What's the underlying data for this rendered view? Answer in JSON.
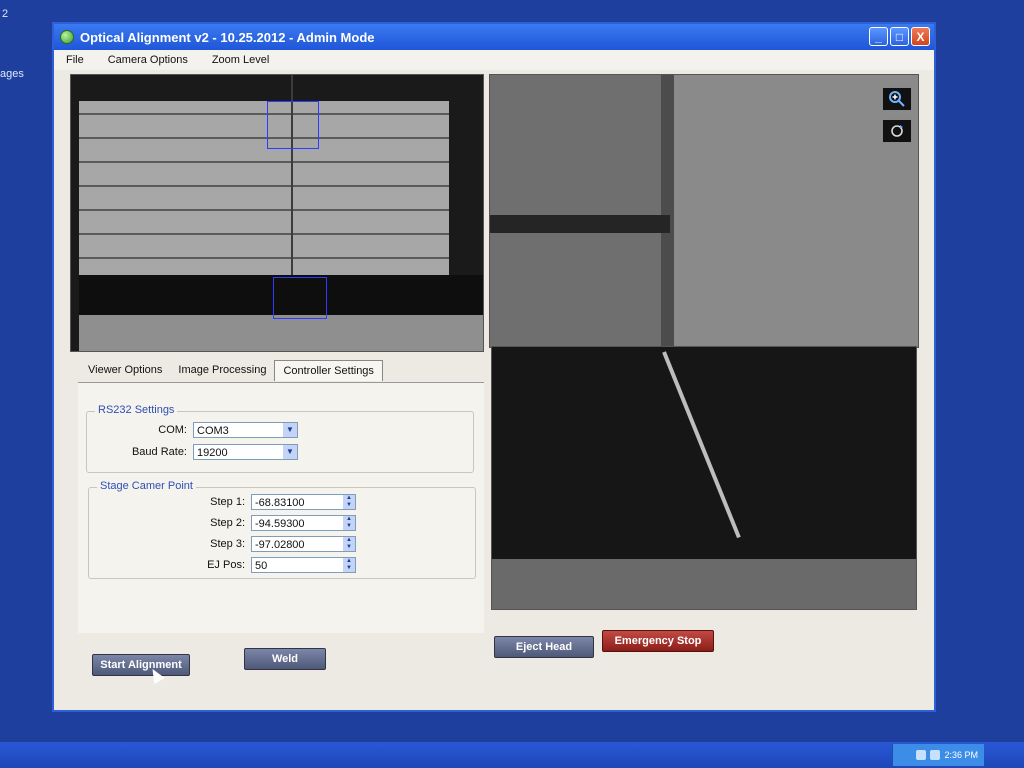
{
  "desktop": {
    "left_texts": [
      "2",
      "ages"
    ]
  },
  "window": {
    "title": "Optical Alignment v2 - 10.25.2012 - Admin Mode",
    "buttons": [
      "_",
      "□",
      "X"
    ]
  },
  "menu": {
    "items": [
      "File",
      "Camera Options",
      "Zoom Level"
    ]
  },
  "tabs": [
    "Viewer Options",
    "Image Processing",
    "Controller Settings"
  ],
  "rs232": {
    "group_title": "RS232 Settings",
    "com_label": "COM:",
    "com_value": "COM3",
    "baud_label": "Baud Rate:",
    "baud_value": "19200"
  },
  "stage": {
    "group_title": "Stage Camer Point",
    "rows": [
      {
        "label": "Step 1:",
        "value": "-68.83100"
      },
      {
        "label": "Step 2:",
        "value": "-94.59300"
      },
      {
        "label": "Step 3:",
        "value": "-97.02800"
      },
      {
        "label": "EJ Pos:",
        "value": "50"
      }
    ]
  },
  "buttons": {
    "start_alignment": "Start Alignment",
    "weld": "Weld",
    "eject_head": "Eject Head",
    "emergency_stop": "Emergency Stop"
  },
  "taskbar": {
    "clock": "2:36 PM"
  },
  "colors": {
    "desktop_bg": "#1f3f9e",
    "titlebar": "#1f56d8",
    "group_title": "#2f4fb4",
    "danger": "#8b1e18"
  },
  "icons": [
    "zoom-in-icon",
    "reset-view-icon",
    "app-icon",
    "dropdown-arrow-icon",
    "spinner-arrows-icon"
  ]
}
